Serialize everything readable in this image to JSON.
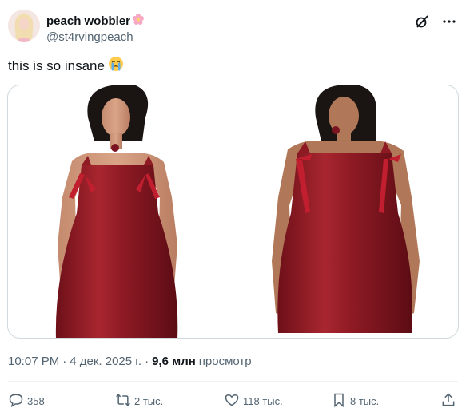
{
  "author": {
    "display_name": "peach wobbler",
    "name_emoji": "flower-emoji",
    "handle": "@st4rvingpeach"
  },
  "tweet": {
    "text": "this is so insane",
    "text_emoji": "crying-face-emoji"
  },
  "media": {
    "left_image": "model-red-dress-front",
    "right_image": "model-red-dress-front-plus"
  },
  "meta": {
    "time": "10:07 PM",
    "date": "4 дек. 2025 г.",
    "views_count": "9,6 млн",
    "views_label": "просмотр"
  },
  "actions": {
    "replies": "358",
    "reposts": "2 тыс.",
    "likes": "118 тыс.",
    "bookmarks": "8 тыс."
  },
  "colors": {
    "text": "#0f1419",
    "secondary": "#536471",
    "border": "#cfd9de",
    "dress": "#8e1a24"
  }
}
